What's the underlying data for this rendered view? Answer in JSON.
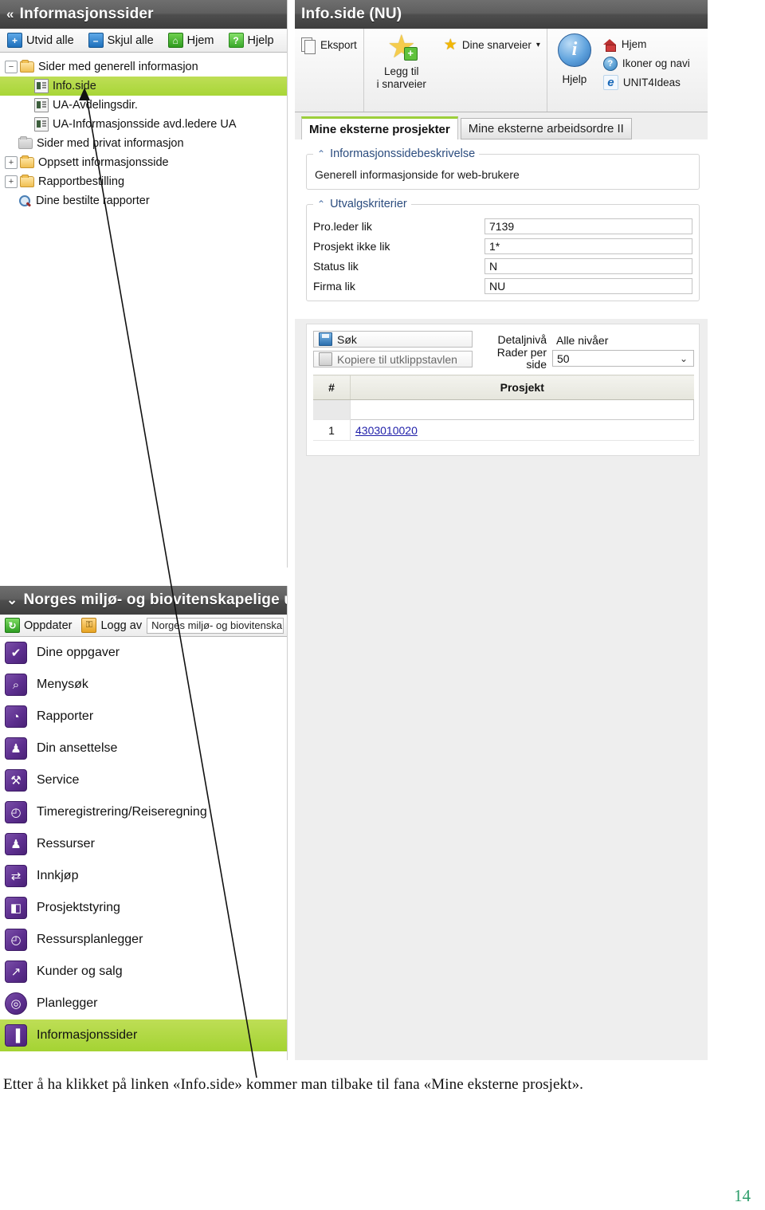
{
  "tree_panel": {
    "title": "Informasjonssider",
    "collapse_chevron": "«",
    "toolbar": [
      {
        "label": "Utvid alle",
        "icon": "plus-icon",
        "glyph": "+"
      },
      {
        "label": "Skjul alle",
        "icon": "minus-icon",
        "glyph": "–"
      },
      {
        "label": "Hjem",
        "icon": "home-icon",
        "glyph": "⌂"
      },
      {
        "label": "Hjelp",
        "icon": "question-icon",
        "glyph": "?"
      }
    ],
    "nodes": [
      {
        "label": "Sider med generell informasjon",
        "toggle": "−",
        "icon": "folder-open-icon",
        "depth": 0,
        "selected": false
      },
      {
        "label": "Info.side",
        "toggle": "",
        "icon": "page-icon",
        "depth": 1,
        "selected": true
      },
      {
        "label": "UA-Avdelingsdir.",
        "toggle": "",
        "icon": "page-icon",
        "depth": 1,
        "selected": false
      },
      {
        "label": "UA-Informasjonsside avd.ledere UA",
        "toggle": "",
        "icon": "page-icon",
        "depth": 1,
        "selected": false
      },
      {
        "label": "Sider med privat informasjon",
        "toggle": "",
        "icon": "folder-gray-icon",
        "depth": 0,
        "selected": false
      },
      {
        "label": "Oppsett informasjonsside",
        "toggle": "+",
        "icon": "folder-icon",
        "depth": 0,
        "selected": false
      },
      {
        "label": "Rapportbestilling",
        "toggle": "+",
        "icon": "folder-icon",
        "depth": 0,
        "selected": false
      },
      {
        "label": "Dine bestilte rapporter",
        "toggle": "",
        "icon": "magnifier-icon",
        "depth": 0,
        "selected": false
      }
    ]
  },
  "content_panel": {
    "title": "Info.side (NU)",
    "toolbar": {
      "export_label": "Eksport",
      "add_shortcut_line1": "Legg til",
      "add_shortcut_line2": "i snarveier",
      "your_shortcuts_label": "Dine snarveier",
      "your_shortcuts_caret": "▾",
      "help_label": "Hjelp",
      "links": [
        {
          "label": "Hjem",
          "icon": "home-icon"
        },
        {
          "label": "Ikoner og navi",
          "icon": "question-circle-icon"
        },
        {
          "label": "UNIT4Ideas",
          "icon": "browser-icon"
        }
      ]
    },
    "tabs": [
      {
        "label": "Mine eksterne prosjekter",
        "active": true
      },
      {
        "label": "Mine eksterne arbeidsordre II",
        "active": false
      }
    ],
    "description_group": {
      "legend": "Informasjonssidebeskrivelse",
      "caret": "⌃",
      "text": "Generell informasjonside for web-brukere"
    },
    "criteria_group": {
      "legend": "Utvalgskriterier",
      "caret": "⌃",
      "fields": [
        {
          "label": "Pro.leder lik",
          "value": "7139"
        },
        {
          "label": "Prosjekt ikke lik",
          "value": "1*"
        },
        {
          "label": "Status lik",
          "value": "N"
        },
        {
          "label": "Firma lik",
          "value": "NU"
        }
      ]
    },
    "results": {
      "buttons": [
        {
          "label": "Søk",
          "icon": "save-icon",
          "enabled": true
        },
        {
          "label": "Kopiere til utklippstavlen",
          "icon": "clipboard-icon",
          "enabled": false
        }
      ],
      "options": [
        {
          "label": "Detaljnivå",
          "value": "Alle nivåer",
          "type": "text"
        },
        {
          "label": "Rader per side",
          "value": "50",
          "type": "select",
          "caret": "⌄"
        }
      ],
      "columns": [
        "#",
        "Prosjekt"
      ],
      "filter_row": [
        "",
        ""
      ],
      "rows": [
        {
          "num": "1",
          "prosjekt": "4303010020"
        }
      ]
    }
  },
  "menu_panel": {
    "title": "Norges miljø- og biovitenskapelige u",
    "collapse_chevron": "⌄",
    "toolbar": {
      "refresh_label": "Oppdater",
      "logout_label": "Logg av",
      "user_value": "Norges miljø- og biovitenska"
    },
    "items": [
      {
        "label": "Dine oppgaver",
        "icon": "check-icon",
        "glyph": "✔",
        "selected": false,
        "round": false
      },
      {
        "label": "Menysøk",
        "icon": "magnifier-icon",
        "glyph": "⌕",
        "selected": false,
        "round": false
      },
      {
        "label": "Rapporter",
        "icon": "pie-chart-icon",
        "glyph": "◔",
        "selected": false,
        "round": false
      },
      {
        "label": "Din ansettelse",
        "icon": "person-gear-icon",
        "glyph": "♟",
        "selected": false,
        "round": false
      },
      {
        "label": "Service",
        "icon": "wrench-icon",
        "glyph": "⚒",
        "selected": false,
        "round": false
      },
      {
        "label": "Timeregistrering/Reiseregning",
        "icon": "clock-currency-icon",
        "glyph": "◴",
        "selected": false,
        "round": false
      },
      {
        "label": "Ressurser",
        "icon": "people-icon",
        "glyph": "♟",
        "selected": false,
        "round": false
      },
      {
        "label": "Innkjøp",
        "icon": "exchange-icon",
        "glyph": "⇄",
        "selected": false,
        "round": false
      },
      {
        "label": "Prosjektstyring",
        "icon": "steps-icon",
        "glyph": "◧",
        "selected": false,
        "round": false
      },
      {
        "label": "Ressursplanlegger",
        "icon": "person-clock-icon",
        "glyph": "◴",
        "selected": false,
        "round": false
      },
      {
        "label": "Kunder og salg",
        "icon": "trend-chart-icon",
        "glyph": "↗",
        "selected": false,
        "round": false
      },
      {
        "label": "Planlegger",
        "icon": "compass-icon",
        "glyph": "◎",
        "selected": false,
        "round": true
      },
      {
        "label": "Informasjonssider",
        "icon": "bar-chart-icon",
        "glyph": "▐",
        "selected": true,
        "round": false
      }
    ]
  },
  "caption": "Etter å ha klikket på linken «Info.side» kommer man tilbake til fana «Mine eksterne prosjekt».",
  "page_number": "14",
  "colors": {
    "selection_green": "#a8d637",
    "accent_tab_green": "#9ccf3a",
    "header_dark": "#4d4d4d",
    "menu_icon_purple": "#5d2f8f",
    "link_blue": "#2222aa",
    "page_number_green": "#2e9e6b"
  }
}
